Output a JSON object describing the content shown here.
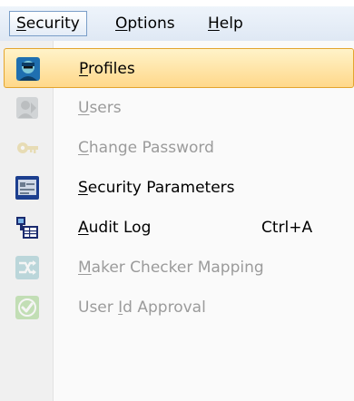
{
  "menubar": {
    "items": [
      {
        "label": "Security",
        "mnemonic": "S",
        "rest": "ecurity"
      },
      {
        "label": "Options",
        "mnemonic": "O",
        "rest": "ptions"
      },
      {
        "label": "Help",
        "mnemonic": "H",
        "rest": "elp"
      }
    ]
  },
  "dropdown": {
    "items": [
      {
        "label": "Profiles",
        "pre": "",
        "mnemonic": "P",
        "post": "rofiles",
        "icon": "profile-agent-icon",
        "enabled": true,
        "highlighted": true
      },
      {
        "label": "Users",
        "pre": "",
        "mnemonic": "U",
        "post": "sers",
        "icon": "users-icon",
        "enabled": false
      },
      {
        "label": "Change Password",
        "pre": "",
        "mnemonic": "C",
        "post": "hange Password",
        "icon": "key-icon",
        "enabled": false
      },
      {
        "label": "Security Parameters",
        "pre": "",
        "mnemonic": "S",
        "post": "ecurity Parameters",
        "icon": "security-parameters-icon",
        "enabled": true
      },
      {
        "label": "Audit Log",
        "pre": "",
        "mnemonic": "A",
        "post": "udit Log",
        "shortcut": "Ctrl+A",
        "icon": "audit-log-icon",
        "enabled": true
      },
      {
        "label": "Maker Checker Mapping",
        "pre": "",
        "mnemonic": "M",
        "post": "aker Checker Mapping",
        "icon": "mapping-icon",
        "enabled": false
      },
      {
        "label": "User Id Approval",
        "pre": "User ",
        "mnemonic": "I",
        "post": "d Approval",
        "icon": "approval-check-icon",
        "enabled": false
      }
    ]
  },
  "colors": {
    "highlight": "#ffd88a",
    "highlight_border": "#e3a52f",
    "disabled_text": "#9b9b9b",
    "menubar_active_border": "#7a9ec8"
  }
}
